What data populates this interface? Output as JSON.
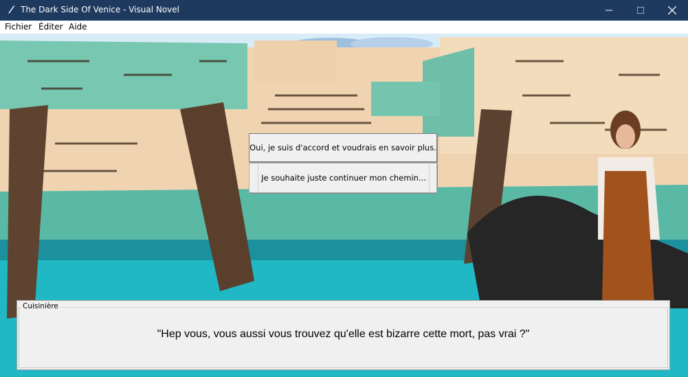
{
  "window": {
    "title": "The Dark Side Of Venice - Visual Novel",
    "icon": "quill-icon"
  },
  "menu": {
    "items": [
      {
        "label": "Fichier"
      },
      {
        "label": "Éditer"
      },
      {
        "label": "Aide"
      }
    ]
  },
  "choices": [
    {
      "label": "Oui, je suis d'accord et voudrais en savoir plus."
    },
    {
      "label": "Je souhaite juste continuer mon chemin..."
    }
  ],
  "dialogue": {
    "speaker": "Cuisinière",
    "text": "\"Hep vous, vous aussi vous trouvez qu'elle est bizarre cette mort, pas vrai ?\""
  },
  "colors": {
    "titlebar": "#1f3a5f",
    "water": "#1fb8c4",
    "wall": "#f1d6b6",
    "teal_wall": "#6cc3ae",
    "sky": "#cfe6f7"
  }
}
